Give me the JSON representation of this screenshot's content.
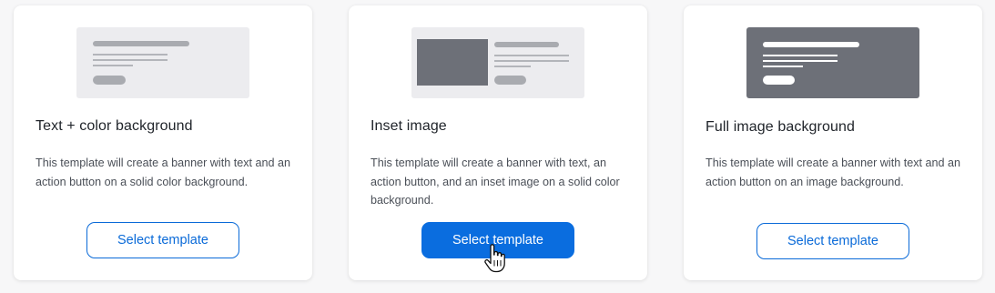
{
  "cards": [
    {
      "title": "Text + color background",
      "description": "This template will create a banner with text and an action button on a solid color background.",
      "button_label": "Select template",
      "thumbnail": "text-color-thumbnail"
    },
    {
      "title": "Inset image",
      "description": "This template will create a banner with text, an action button, and an inset image on a solid color background.",
      "button_label": "Select template",
      "thumbnail": "inset-image-thumbnail"
    },
    {
      "title": "Full image background",
      "description": "This template will create a banner with text and an action button on an image background.",
      "button_label": "Select template",
      "thumbnail": "full-image-thumbnail"
    }
  ],
  "colors": {
    "accent": "#0a6ddf",
    "thumbnail_light": "#ececef",
    "thumbnail_dark": "#6d7078",
    "placeholder_gray": "#a9abb0"
  },
  "hovered_card": 1,
  "cursor": "hand-pointer-icon"
}
